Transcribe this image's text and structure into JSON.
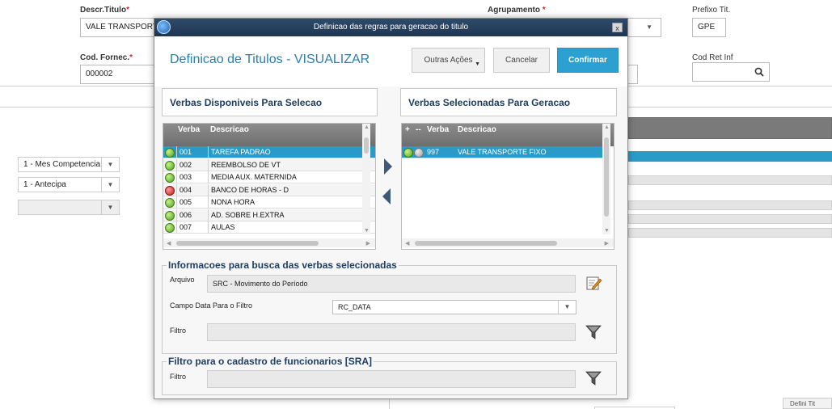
{
  "background_form": {
    "descr_titulo_label": "Descr.Titulo",
    "descr_titulo_value": "VALE TRANSPORT",
    "agrupamento_label": "Agrupamento",
    "prefixo_label": "Prefixo Tit.",
    "prefixo_value": "GPE",
    "cod_fornec_label": "Cod. Fornec.",
    "cod_fornec_value": "000002",
    "cod_ret_label": "Cod Ret Inf",
    "select_competencia": "1 - Mes Competencia",
    "select_antecipa": "1 - Antecipa",
    "select_empty": "",
    "required_mark": "*",
    "bottom_right_text": "Defini Tit"
  },
  "modal": {
    "window_title": "Definicao das regras para geracao do titulo",
    "close_label": "x",
    "heading": "Definicao de Titulos - VISUALIZAR",
    "buttons": {
      "outras_acoes": "Outras Ações",
      "cancelar": "Cancelar",
      "confirmar": "Confirmar"
    },
    "left_panel_title": "Verbas Disponiveis Para Selecao",
    "right_panel_title": "Verbas Selecionadas Para Geracao",
    "left_grid": {
      "headers": [
        "Verba",
        "Descricao"
      ],
      "rows": [
        {
          "status": "green",
          "verba": "001",
          "descricao": "TAREFA PADRAO",
          "selected": true
        },
        {
          "status": "green",
          "verba": "002",
          "descricao": "REEMBOLSO DE VT",
          "selected": false
        },
        {
          "status": "green",
          "verba": "003",
          "descricao": "MEDIA AUX. MATERNIDA",
          "selected": false
        },
        {
          "status": "red",
          "verba": "004",
          "descricao": "BANCO DE HORAS - D",
          "selected": false
        },
        {
          "status": "green",
          "verba": "005",
          "descricao": "NONA HORA",
          "selected": false
        },
        {
          "status": "green",
          "verba": "006",
          "descricao": "AD. SOBRE H.EXTRA",
          "selected": false
        },
        {
          "status": "green",
          "verba": "007",
          "descricao": "AULAS",
          "selected": false
        }
      ]
    },
    "right_grid": {
      "headers": [
        "+",
        "--",
        "Verba",
        "Descricao"
      ],
      "rows": [
        {
          "status": "green",
          "status2": "gray",
          "verba": "997",
          "descricao": "VALE TRANSPORTE FIXO",
          "selected": true
        }
      ]
    },
    "info_group": {
      "legend": "Informacoes para busca das verbas selecionadas",
      "arquivo_label": "Arquivo",
      "arquivo_value": "SRC - Movimento do Período",
      "campo_data_label": "Campo Data Para o Filtro",
      "campo_data_value": "RC_DATA",
      "filtro_label": "Filtro",
      "filtro_value": ""
    },
    "sra_group": {
      "legend": "Filtro para o cadastro de funcionarios [SRA]",
      "filtro_label": "Filtro",
      "filtro_value": ""
    }
  },
  "colors": {
    "primary": "#2ca0d0",
    "heading": "#2a7fae",
    "panel_title": "#1f3d63",
    "selected_row": "#2a9bc9"
  }
}
